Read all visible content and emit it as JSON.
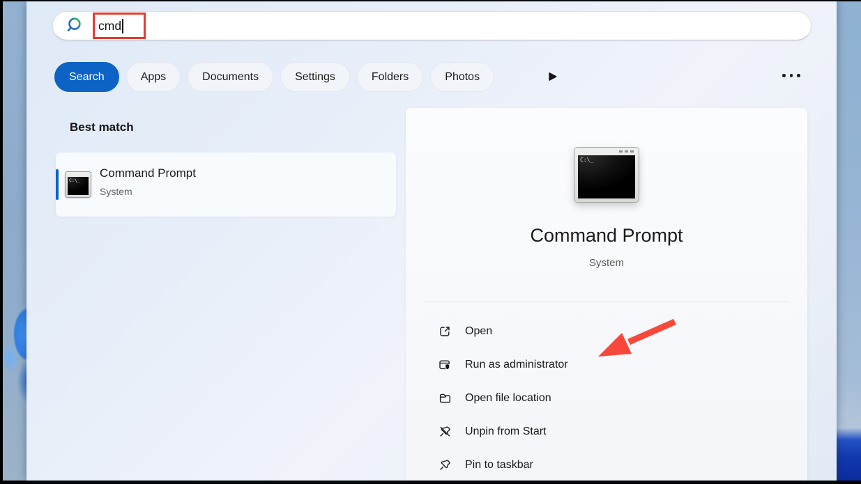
{
  "search_bar": {
    "query": "cmd",
    "icon": "search-magnifier"
  },
  "filter_tabs": [
    {
      "label": "Search",
      "active": true
    },
    {
      "label": "Apps",
      "active": false
    },
    {
      "label": "Documents",
      "active": false
    },
    {
      "label": "Settings",
      "active": false
    },
    {
      "label": "Folders",
      "active": false
    },
    {
      "label": "Photos",
      "active": false
    }
  ],
  "toolbar": {
    "more_filters_icon": "play-triangle",
    "more_options_icon": "ellipsis"
  },
  "results": {
    "section_title": "Best match",
    "best_match": {
      "title": "Command Prompt",
      "subtitle": "System",
      "icon": "command-prompt-window",
      "icon_text": "C:\\_"
    }
  },
  "preview": {
    "icon": "command-prompt-window",
    "icon_text": "C:\\_",
    "title": "Command Prompt",
    "subtitle": "System",
    "actions": [
      {
        "icon": "open-external-icon",
        "label": "Open"
      },
      {
        "icon": "run-as-administrator-icon",
        "label": "Run as administrator"
      },
      {
        "icon": "open-file-location-icon",
        "label": "Open file location"
      },
      {
        "icon": "unpin-from-start-icon",
        "label": "Unpin from Start"
      },
      {
        "icon": "pin-to-taskbar-icon",
        "label": "Pin to taskbar"
      }
    ]
  },
  "annotations": {
    "highlight_box_target": "search query cmd",
    "highlight_color": "#e63b2e",
    "arrow_target": "Run as administrator",
    "arrow_color": "#f8483b"
  },
  "colors": {
    "accent_blue": "#0c63c5",
    "panel_tint": "#e7eef9"
  }
}
